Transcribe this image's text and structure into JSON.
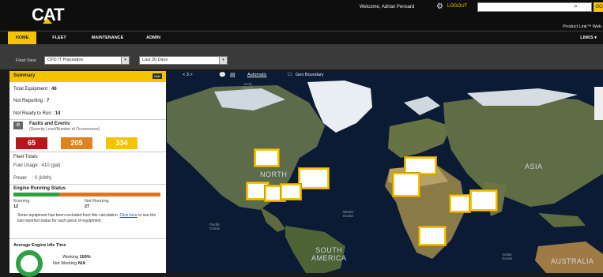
{
  "header": {
    "logo_text": "CAT",
    "welcome": "Welcome, Adrian Pensard",
    "logout": "LOGOUT",
    "search_placeholder": "",
    "go_label": "GO",
    "product_link": "Product Link™ Web"
  },
  "nav": {
    "items": [
      {
        "label": "HOME",
        "active": true
      },
      {
        "label": "FLEET",
        "active": false
      },
      {
        "label": "MAINTENANCE",
        "active": false
      },
      {
        "label": "ADMIN",
        "active": false
      }
    ],
    "links_label": "LINKS"
  },
  "filters": {
    "fleet_view_label": "Fleet View",
    "fleet_view_value": "CPD IT Population",
    "period_value": "Last 30 Days"
  },
  "summary": {
    "title": "Summary",
    "toggle": "hide",
    "total_equipment_label": "Total Equipment",
    "total_equipment_value": "46",
    "not_reporting_label": "Not Reporting",
    "not_reporting_value": "7",
    "not_ready_label": "Not Ready to Run",
    "not_ready_value": "14",
    "faults_title": "Faults and Events",
    "faults_sub": "(Severity Level/Number of Occurrences)",
    "severity": [
      {
        "value": "65",
        "color": "#b3191b"
      },
      {
        "value": "205",
        "color": "#e0831e"
      },
      {
        "value": "334",
        "color": "#f5c400"
      }
    ],
    "fleet_totals_title": "Fleet Totals",
    "fuel_usage": "Fuel Usage : 410 (gal)",
    "power": "Power",
    "power_value": ": 0 (kWh)",
    "engine_running_title": "Engine Running Status",
    "running_label": "Running",
    "running_value": "12",
    "not_running_label": "Not Running",
    "not_running_value": "27",
    "running_fraction": 0.31,
    "note_text": "Some equipment has been excluded from this calculation.",
    "note_link": "Click here",
    "note_tail": "to see the last reported status for each piece of equipment.",
    "idle_title": "Average Engine Idle Time",
    "working_label": "Working",
    "working_value": "100%",
    "not_working_label": "Not Working",
    "not_working_value": "N/A"
  },
  "map": {
    "zoom_label": "< 3 >",
    "mode": "Automatic",
    "geo_boundary": "Geo Boundary",
    "labels": {
      "north_america": "NORTH",
      "asia": "ASIA",
      "south_america": "SOUTH\nAMERICA",
      "australia": "AUSTRALIA",
      "arctic_ocean": "Arctic\nOcean",
      "pacific_ocean": "Pacific\nOcean",
      "atlantic_ocean": "Atlantic\nOcean",
      "indian_ocean": "Indian\nOcean"
    }
  }
}
